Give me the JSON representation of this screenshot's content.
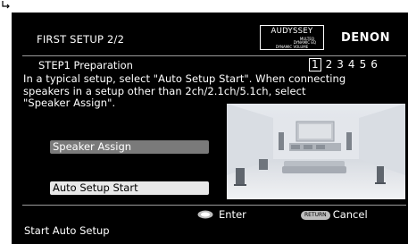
{
  "header": {
    "title": "FIRST SETUP 2/2",
    "audyssey_logo": {
      "main": "AUDYSSEY",
      "line1": "MULTEQ",
      "line2": "DYNAMIC EQ",
      "line3": "DYNAMIC VOLUME"
    },
    "brand": "DENON"
  },
  "step": {
    "label": "STEP1 Preparation",
    "numbers": [
      "1",
      "2",
      "3",
      "4",
      "5",
      "6"
    ],
    "active_index": 0
  },
  "description": {
    "lines": [
      "In a typical setup, select  \"Auto Setup Start\". When connecting",
      "speakers in a setup other than 2ch/2.1ch/5.1ch, select",
      "\"Speaker Assign\"."
    ]
  },
  "menu": {
    "items": [
      {
        "label": "Speaker Assign",
        "selected": false
      },
      {
        "label": "Auto Setup Start",
        "selected": true
      }
    ]
  },
  "hints": {
    "enter_label": "Enter",
    "return_icon_text": "RETURN",
    "cancel_label": "Cancel"
  },
  "status": {
    "text": "Start Auto Setup"
  },
  "colors": {
    "background": "#000000",
    "text": "#ffffff",
    "selected_button": "#e8e8e8",
    "unselected_button": "#7a7a7a",
    "divider": "#9a9a9a"
  }
}
